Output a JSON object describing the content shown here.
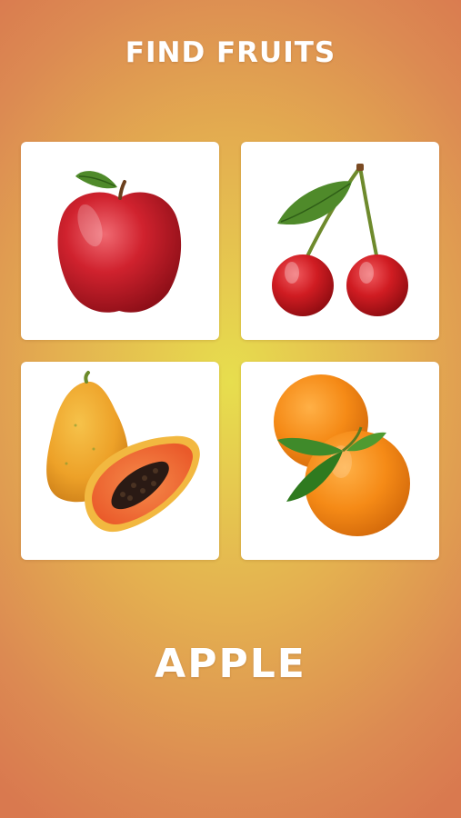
{
  "header": {
    "title": "FIND FRUITS"
  },
  "cards": [
    {
      "fruit": "apple-icon"
    },
    {
      "fruit": "cherries-icon"
    },
    {
      "fruit": "papaya-icon"
    },
    {
      "fruit": "oranges-icon"
    }
  ],
  "prompt": {
    "word": "APPLE"
  },
  "colors": {
    "background_center": "#e7de4e",
    "background_edge": "#d9794f",
    "card": "#ffffff",
    "text": "#ffffff"
  }
}
